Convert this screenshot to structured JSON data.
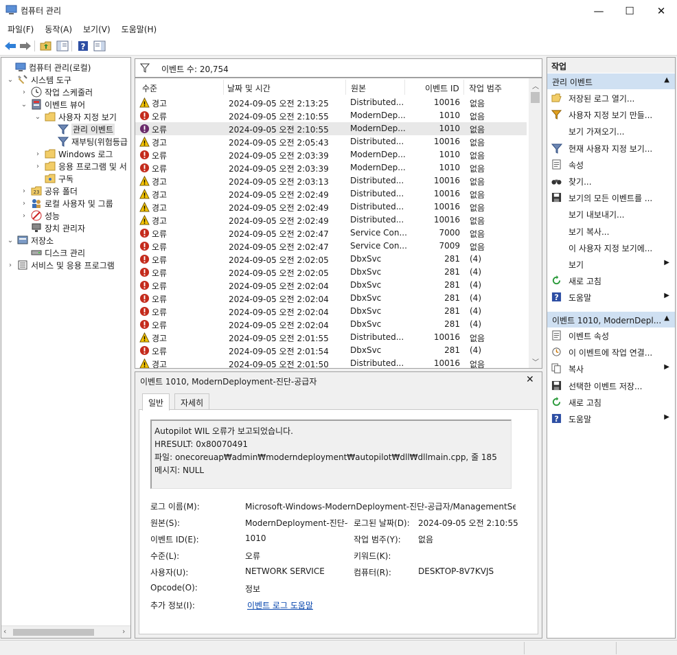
{
  "window": {
    "title": "컴퓨터 관리",
    "minimize": "—",
    "maximize": "☐",
    "close": "✕"
  },
  "menu": [
    "파일(F)",
    "동작(A)",
    "보기(V)",
    "도움말(H)"
  ],
  "tree": [
    {
      "label": "컴퓨터 관리(로컬)",
      "icon": "computer-management-icon",
      "exp": ""
    },
    {
      "label": "시스템 도구",
      "icon": "tools-icon",
      "exp": "⌄"
    },
    {
      "label": "작업 스케줄러",
      "icon": "clock-icon",
      "exp": "›"
    },
    {
      "label": "이벤트 뷰어",
      "icon": "event-viewer-icon",
      "exp": "⌄"
    },
    {
      "label": "사용자 지정 보기",
      "icon": "folder-icon",
      "exp": "⌄"
    },
    {
      "label": "관리 이벤트",
      "icon": "filter-icon",
      "exp": ""
    },
    {
      "label": "재부팅(위험등급",
      "icon": "filter-icon",
      "exp": ""
    },
    {
      "label": "Windows 로그",
      "icon": "folder-icon",
      "exp": "›"
    },
    {
      "label": "응용 프로그램 및 서",
      "icon": "folder-icon",
      "exp": "›"
    },
    {
      "label": "구독",
      "icon": "subscription-icon",
      "exp": ""
    },
    {
      "label": "공유 폴더",
      "icon": "shared-folder-icon",
      "exp": "›"
    },
    {
      "label": "로컬 사용자 및 그룹",
      "icon": "users-icon",
      "exp": "›"
    },
    {
      "label": "성능",
      "icon": "performance-icon",
      "exp": "›"
    },
    {
      "label": "장치 관리자",
      "icon": "device-manager-icon",
      "exp": ""
    },
    {
      "label": "저장소",
      "icon": "storage-icon",
      "exp": "⌄"
    },
    {
      "label": "디스크 관리",
      "icon": "disk-icon",
      "exp": ""
    },
    {
      "label": "서비스 및 응용 프로그램",
      "icon": "services-icon",
      "exp": "›"
    }
  ],
  "event_list": {
    "count_label": "이벤트 수: 20,754",
    "columns": [
      "수준",
      "날짜 및 시간",
      "원본",
      "이벤트 ID",
      "작업 범주"
    ],
    "rows": [
      {
        "level": "경고",
        "type": "warn",
        "date": "2024-09-05 오전 2:13:25",
        "source": "Distributed...",
        "id": "10016",
        "cat": "없음"
      },
      {
        "level": "오류",
        "type": "err",
        "date": "2024-09-05 오전 2:10:55",
        "source": "ModernDep...",
        "id": "1010",
        "cat": "없음"
      },
      {
        "level": "오류",
        "type": "err",
        "date": "2024-09-05 오전 2:10:55",
        "source": "ModernDep...",
        "id": "1010",
        "cat": "없음"
      },
      {
        "level": "경고",
        "type": "warn",
        "date": "2024-09-05 오전 2:05:43",
        "source": "Distributed...",
        "id": "10016",
        "cat": "없음"
      },
      {
        "level": "오류",
        "type": "err",
        "date": "2024-09-05 오전 2:03:39",
        "source": "ModernDep...",
        "id": "1010",
        "cat": "없음"
      },
      {
        "level": "오류",
        "type": "err",
        "date": "2024-09-05 오전 2:03:39",
        "source": "ModernDep...",
        "id": "1010",
        "cat": "없음"
      },
      {
        "level": "경고",
        "type": "warn",
        "date": "2024-09-05 오전 2:03:13",
        "source": "Distributed...",
        "id": "10016",
        "cat": "없음"
      },
      {
        "level": "경고",
        "type": "warn",
        "date": "2024-09-05 오전 2:02:49",
        "source": "Distributed...",
        "id": "10016",
        "cat": "없음"
      },
      {
        "level": "경고",
        "type": "warn",
        "date": "2024-09-05 오전 2:02:49",
        "source": "Distributed...",
        "id": "10016",
        "cat": "없음"
      },
      {
        "level": "경고",
        "type": "warn",
        "date": "2024-09-05 오전 2:02:49",
        "source": "Distributed...",
        "id": "10016",
        "cat": "없음"
      },
      {
        "level": "오류",
        "type": "err",
        "date": "2024-09-05 오전 2:02:47",
        "source": "Service Con...",
        "id": "7000",
        "cat": "없음"
      },
      {
        "level": "오류",
        "type": "err",
        "date": "2024-09-05 오전 2:02:47",
        "source": "Service Con...",
        "id": "7009",
        "cat": "없음"
      },
      {
        "level": "오류",
        "type": "err",
        "date": "2024-09-05 오전 2:02:05",
        "source": "DbxSvc",
        "id": "281",
        "cat": "(4)"
      },
      {
        "level": "오류",
        "type": "err",
        "date": "2024-09-05 오전 2:02:05",
        "source": "DbxSvc",
        "id": "281",
        "cat": "(4)"
      },
      {
        "level": "오류",
        "type": "err",
        "date": "2024-09-05 오전 2:02:04",
        "source": "DbxSvc",
        "id": "281",
        "cat": "(4)"
      },
      {
        "level": "오류",
        "type": "err",
        "date": "2024-09-05 오전 2:02:04",
        "source": "DbxSvc",
        "id": "281",
        "cat": "(4)"
      },
      {
        "level": "오류",
        "type": "err",
        "date": "2024-09-05 오전 2:02:04",
        "source": "DbxSvc",
        "id": "281",
        "cat": "(4)"
      },
      {
        "level": "오류",
        "type": "err",
        "date": "2024-09-05 오전 2:02:04",
        "source": "DbxSvc",
        "id": "281",
        "cat": "(4)"
      },
      {
        "level": "경고",
        "type": "warn",
        "date": "2024-09-05 오전 2:01:55",
        "source": "Distributed...",
        "id": "10016",
        "cat": "없음"
      },
      {
        "level": "오류",
        "type": "err",
        "date": "2024-09-05 오전 2:01:54",
        "source": "DbxSvc",
        "id": "281",
        "cat": "(4)"
      },
      {
        "level": "경고",
        "type": "warn",
        "date": "2024-09-05 오전 2:01:50",
        "source": "Distributed...",
        "id": "10016",
        "cat": "없음"
      }
    ]
  },
  "detail": {
    "title": "이벤트 1010, ModernDeployment-진단-공급자",
    "close": "✕",
    "tabs": [
      "일반",
      "자세히"
    ],
    "description": "Autopilot WIL 오류가 보고되었습니다.\nHRESULT: 0x80070491\n파일: onecoreuap₩admin₩moderndeployment₩autopilot₩dll₩dllmain.cpp, 줄 185\n메시지: NULL",
    "fields": {
      "log_name_label": "로그 이름(M):",
      "log_name": "Microsoft-Windows-ModernDeployment-진단-공급자/ManagementServic",
      "source_label": "원본(S):",
      "source": "ModernDeployment-진단-공",
      "logged_label": "로그된 날짜(D):",
      "logged": "2024-09-05 오전 2:10:55",
      "event_id_label": "이벤트 ID(E):",
      "event_id": "1010",
      "task_label": "작업 범주(Y):",
      "task": "없음",
      "level_label": "수준(L):",
      "level": "오류",
      "keywords_label": "키워드(K):",
      "user_label": "사용자(U):",
      "user": "NETWORK SERVICE",
      "computer_label": "컴퓨터(R):",
      "computer": "DESKTOP-8V7KVJS",
      "opcode_label": "Opcode(O):",
      "opcode": "정보",
      "more_label": "추가 정보(I):",
      "more_link": "이벤트 로그 도움말"
    }
  },
  "actions": {
    "title": "작업",
    "section1": "관리 이벤트",
    "items1": [
      {
        "label": "저장된 로그 열기...",
        "icon": "open-folder-icon",
        "arrow": false
      },
      {
        "label": "사용자 지정 보기 만들...",
        "icon": "create-filter-icon",
        "arrow": false
      },
      {
        "label": "보기 가져오기...",
        "icon": "",
        "arrow": false
      },
      {
        "label": "현재 사용자 지정 보기...",
        "icon": "filter-icon",
        "arrow": false
      },
      {
        "label": "속성",
        "icon": "properties-icon",
        "arrow": false
      },
      {
        "label": "찾기...",
        "icon": "binoculars-icon",
        "arrow": false
      },
      {
        "label": "보기의 모든 이벤트를 ...",
        "icon": "save-icon",
        "arrow": false
      },
      {
        "label": "보기 내보내기...",
        "icon": "",
        "arrow": false
      },
      {
        "label": "보기 복사...",
        "icon": "",
        "arrow": false
      },
      {
        "label": "이 사용자 지정 보기에...",
        "icon": "",
        "arrow": false
      },
      {
        "label": "보기",
        "icon": "",
        "arrow": true
      },
      {
        "label": "새로 고침",
        "icon": "refresh-icon",
        "arrow": false
      },
      {
        "label": "도움말",
        "icon": "help-icon",
        "arrow": true
      }
    ],
    "section2": "이벤트 1010, ModernDepl...",
    "items2": [
      {
        "label": "이벤트 속성",
        "icon": "properties-icon",
        "arrow": false
      },
      {
        "label": "이 이벤트에 작업 연결...",
        "icon": "attach-task-icon",
        "arrow": false
      },
      {
        "label": "복사",
        "icon": "copy-icon",
        "arrow": true
      },
      {
        "label": "선택한 이벤트 저장...",
        "icon": "save-icon",
        "arrow": false
      },
      {
        "label": "새로 고침",
        "icon": "refresh-icon",
        "arrow": false
      },
      {
        "label": "도움말",
        "icon": "help-icon",
        "arrow": true
      }
    ]
  },
  "colors": {
    "accent_section": "#cfe0f2",
    "error": "#c42b1c",
    "warning": "#f5c400"
  }
}
